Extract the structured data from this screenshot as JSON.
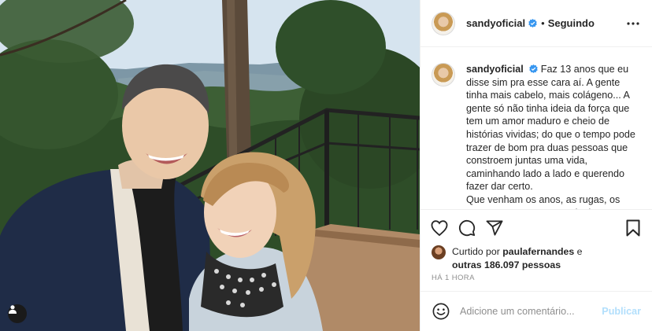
{
  "post": {
    "author": "sandyoficial",
    "follow_status": "Seguindo",
    "separator": "•",
    "caption_lines": [
      "Faz 13 anos que eu disse sim pra esse cara aí. A gente tinha mais cabelo, mais colágeno... A gente só não tinha ideia da força que tem um amor maduro e cheio de histórias vividas; do que o tempo pode trazer de bom pra duas pessoas que constroem juntas uma vida, caminhando lado a lado e querendo fazer dar certo.",
      "Que venham os anos, as rugas, os pequenos tropeços e mais das nossas"
    ],
    "liked_by_prefix": "Curtido por",
    "liked_by_user": "paulafernandes",
    "liked_by_conj": "e",
    "liked_by_others": "outras 186.097 pessoas",
    "timestamp": "HÁ 1 HORA"
  },
  "comment_form": {
    "placeholder": "Adicione um comentário...",
    "submit_label": "Publicar"
  },
  "icons": {
    "verified": "verified-badge-icon",
    "more": "more-options-icon",
    "like": "heart-icon",
    "comment": "comment-bubble-icon",
    "share": "paper-plane-icon",
    "save": "bookmark-icon",
    "emoji": "emoji-icon",
    "tag": "user-tag-icon"
  },
  "colors": {
    "verified_blue": "#3897f0",
    "publish_disabled": "#b2dffc",
    "muted_text": "#8e8e8e",
    "border": "#efefef"
  }
}
